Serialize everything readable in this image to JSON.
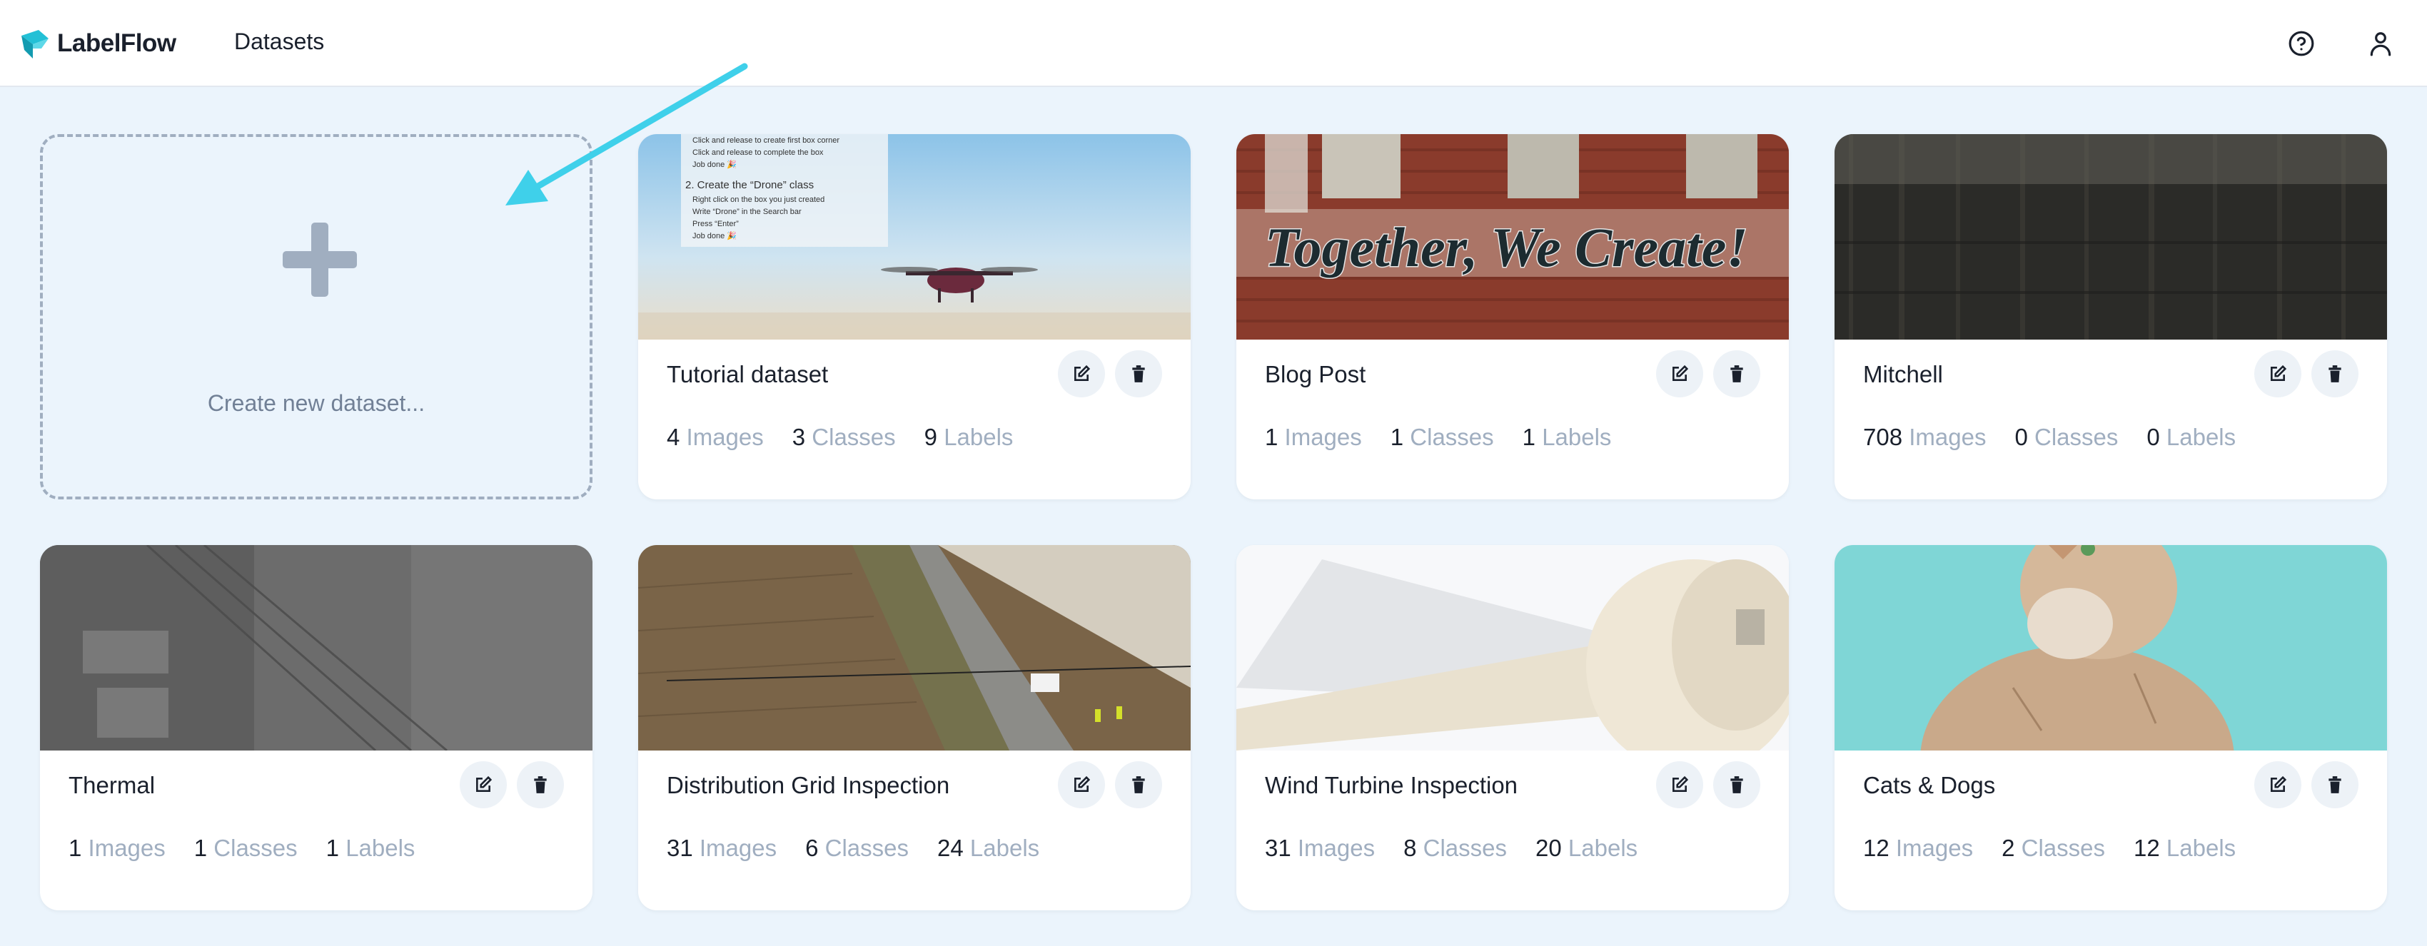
{
  "app": {
    "name": "LabelFlow"
  },
  "nav": {
    "datasets_label": "Datasets",
    "help_icon": "help-circle-icon",
    "user_icon": "user-icon"
  },
  "create": {
    "label": "Create new dataset...",
    "icon": "plus-icon"
  },
  "colors": {
    "brand": "#23c0d6",
    "background": "#ebf4fc",
    "muted_text": "#a0aec0",
    "arrow": "#3fd0ea"
  },
  "units": {
    "images": "Images",
    "classes": "Classes",
    "labels": "Labels"
  },
  "tutorial_image_text": {
    "line1": "Click and release to create first box corner",
    "line2": "Click and release to complete the box",
    "line3": "Job done 🎉",
    "step2": "2. Create the “Drone” class",
    "line4": "Right click on the box you just created",
    "line5": "Write “Drone” in the Search bar",
    "line6": "Press “Enter”",
    "line7": "Job done 🎉"
  },
  "blog_image_text": "Together, We Create!",
  "datasets": [
    {
      "name": "Tutorial dataset",
      "images": "4",
      "classes": "3",
      "labels": "9",
      "thumbnail": "drone-in-sky"
    },
    {
      "name": "Blog Post",
      "images": "1",
      "classes": "1",
      "labels": "1",
      "thumbnail": "graffiti-wall"
    },
    {
      "name": "Mitchell",
      "images": "708",
      "classes": "0",
      "labels": "0",
      "thumbnail": "dark-wooden-fence"
    },
    {
      "name": "Thermal",
      "images": "1",
      "classes": "1",
      "labels": "1",
      "thumbnail": "thermal-aerial-grid"
    },
    {
      "name": "Distribution Grid Inspection",
      "images": "31",
      "classes": "6",
      "labels": "24",
      "thumbnail": "aerial-road-power-lines"
    },
    {
      "name": "Wind Turbine Inspection",
      "images": "31",
      "classes": "8",
      "labels": "20",
      "thumbnail": "wind-turbine-blade"
    },
    {
      "name": "Cats & Dogs",
      "images": "12",
      "classes": "2",
      "labels": "12",
      "thumbnail": "kitten"
    }
  ]
}
